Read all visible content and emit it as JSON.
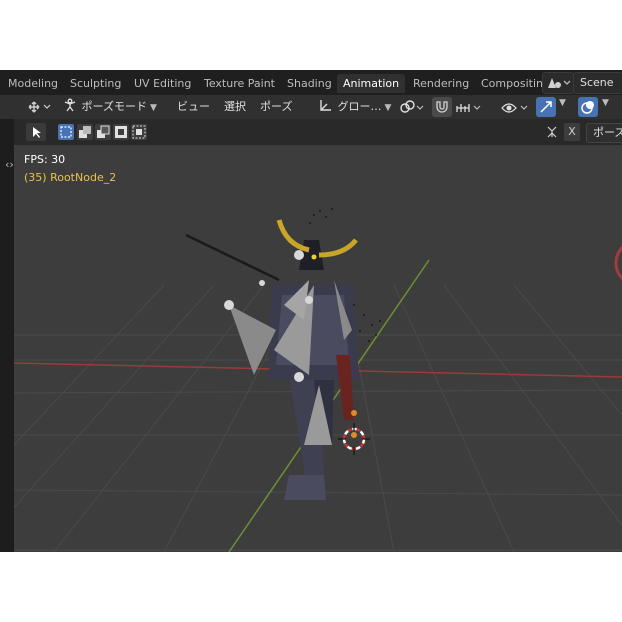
{
  "workspace_tabs": [
    {
      "label": "Modeling",
      "active": false
    },
    {
      "label": "Sculpting",
      "active": false
    },
    {
      "label": "UV Editing",
      "active": false
    },
    {
      "label": "Texture Paint",
      "active": false
    },
    {
      "label": "Shading",
      "active": false
    },
    {
      "label": "Animation",
      "active": true
    },
    {
      "label": "Rendering",
      "active": false
    },
    {
      "label": "Compositin",
      "active": false
    }
  ],
  "scene": {
    "label": "Scene"
  },
  "header": {
    "mode": "ポーズモード",
    "menu_view": "ビュー",
    "menu_select": "選択",
    "menu_pose": "ポーズ",
    "transform_orientation": "グロー…"
  },
  "toolbar": {
    "right_label": "ポーズ"
  },
  "viewport": {
    "fps": "FPS: 30",
    "object_info": "(35) RootNode_2"
  },
  "colors": {
    "accent": "#4772b3",
    "overlay_text": "#ffffff",
    "object_text": "#e8c24a",
    "x_axis": "#9b3a3a",
    "y_axis": "#6d8f36"
  }
}
